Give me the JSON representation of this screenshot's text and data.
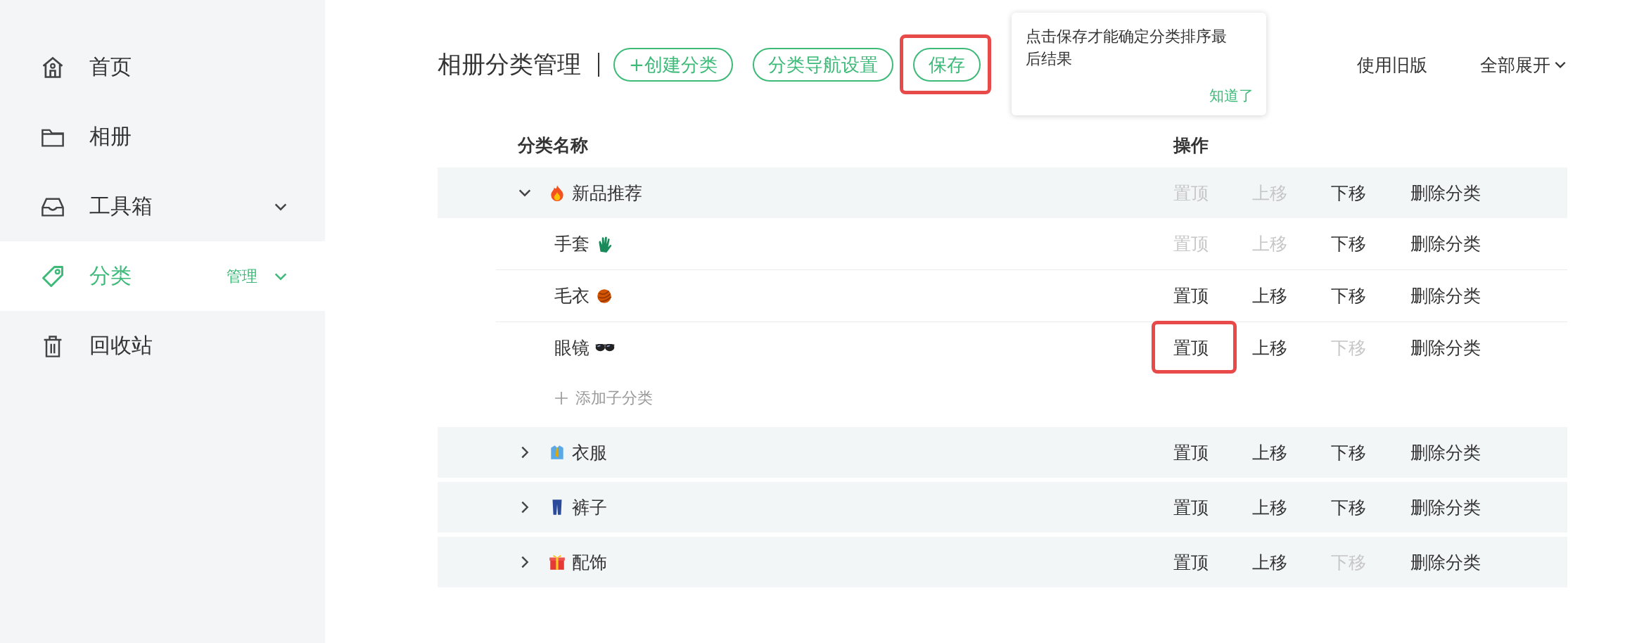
{
  "sidebar": {
    "items": [
      {
        "label": "首页",
        "kind": "home",
        "selected": false,
        "dropdown": false
      },
      {
        "label": "相册",
        "kind": "folder",
        "selected": false,
        "dropdown": false
      },
      {
        "label": "工具箱",
        "kind": "inbox",
        "selected": false,
        "dropdown": true
      },
      {
        "label": "分类",
        "kind": "tag",
        "selected": true,
        "dropdown": true,
        "badge": "管理"
      },
      {
        "label": "回收站",
        "kind": "trash",
        "selected": false,
        "dropdown": false
      }
    ]
  },
  "header": {
    "title": "相册分类管理",
    "buttons": [
      {
        "label": "+创建分类",
        "highlighted": false
      },
      {
        "label": "分类导航设置",
        "highlighted": false
      },
      {
        "label": "保存",
        "highlighted": true
      }
    ],
    "tooltip": {
      "text": "点击保存才能确定分类排序最后结果",
      "action": "知道了"
    },
    "links": [
      {
        "label": "使用旧版",
        "caret": false
      },
      {
        "label": "全部展开",
        "caret": true
      }
    ]
  },
  "table": {
    "columns": [
      "分类名称",
      "操作"
    ],
    "groups": [
      {
        "name": "新品推荐",
        "kind": "flame",
        "expanded": true,
        "actions": [
          {
            "label": "置顶",
            "disabled": true,
            "highlighted": false
          },
          {
            "label": "上移",
            "disabled": true,
            "highlighted": false
          },
          {
            "label": "下移",
            "disabled": false,
            "highlighted": false
          },
          {
            "label": "删除分类",
            "disabled": false,
            "highlighted": false
          }
        ],
        "children": [
          {
            "name": "手套",
            "kind": "glove",
            "actions": [
              {
                "label": "置顶",
                "disabled": true,
                "highlighted": false
              },
              {
                "label": "上移",
                "disabled": true,
                "highlighted": false
              },
              {
                "label": "下移",
                "disabled": false,
                "highlighted": false
              },
              {
                "label": "删除分类",
                "disabled": false,
                "highlighted": false
              }
            ]
          },
          {
            "name": "毛衣",
            "kind": "yarn",
            "actions": [
              {
                "label": "置顶",
                "disabled": false,
                "highlighted": false
              },
              {
                "label": "上移",
                "disabled": false,
                "highlighted": false
              },
              {
                "label": "下移",
                "disabled": false,
                "highlighted": false
              },
              {
                "label": "删除分类",
                "disabled": false,
                "highlighted": false
              }
            ]
          },
          {
            "name": "眼镜",
            "kind": "glasses",
            "actions": [
              {
                "label": "置顶",
                "disabled": false,
                "highlighted": true
              },
              {
                "label": "上移",
                "disabled": false,
                "highlighted": false
              },
              {
                "label": "下移",
                "disabled": true,
                "highlighted": false
              },
              {
                "label": "删除分类",
                "disabled": false,
                "highlighted": false
              }
            ]
          }
        ],
        "add_child": "添加子分类"
      },
      {
        "name": "衣服",
        "kind": "shirt",
        "expanded": false,
        "actions": [
          {
            "label": "置顶",
            "disabled": false,
            "highlighted": false
          },
          {
            "label": "上移",
            "disabled": false,
            "highlighted": false
          },
          {
            "label": "下移",
            "disabled": false,
            "highlighted": false
          },
          {
            "label": "删除分类",
            "disabled": false,
            "highlighted": false
          }
        ]
      },
      {
        "name": "裤子",
        "kind": "jeans",
        "expanded": false,
        "actions": [
          {
            "label": "置顶",
            "disabled": false,
            "highlighted": false
          },
          {
            "label": "上移",
            "disabled": false,
            "highlighted": false
          },
          {
            "label": "下移",
            "disabled": false,
            "highlighted": false
          },
          {
            "label": "删除分类",
            "disabled": false,
            "highlighted": false
          }
        ]
      },
      {
        "name": "配饰",
        "kind": "gift",
        "expanded": false,
        "actions": [
          {
            "label": "置顶",
            "disabled": false,
            "highlighted": false
          },
          {
            "label": "上移",
            "disabled": false,
            "highlighted": false
          },
          {
            "label": "下移",
            "disabled": true,
            "highlighted": false
          },
          {
            "label": "删除分类",
            "disabled": false,
            "highlighted": false
          }
        ]
      }
    ]
  }
}
